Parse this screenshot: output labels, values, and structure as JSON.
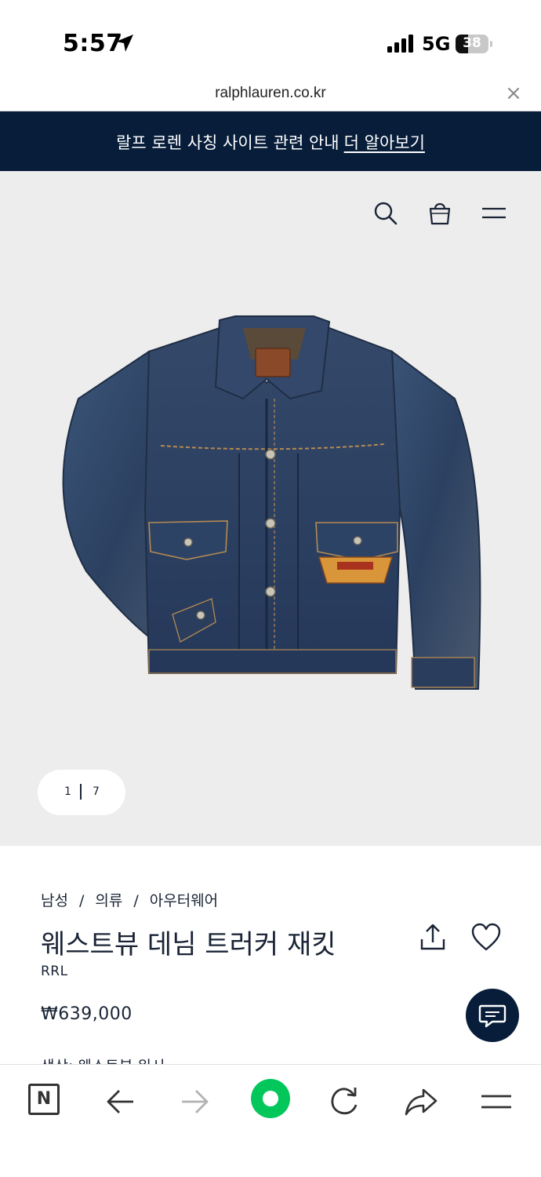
{
  "status_bar": {
    "time": "5:57",
    "network": "5G",
    "battery_level": "38",
    "battery_fraction": 0.38
  },
  "browser": {
    "url": "ralphlauren.co.kr",
    "close_symbol": "×"
  },
  "banner": {
    "text": "랄프 로렌 사칭 사이트 관련 안내",
    "link_text": "더 알아보기",
    "background": "#071d3a"
  },
  "header_icons": [
    "search-icon",
    "shopping-bag-icon",
    "menu-icon"
  ],
  "gallery": {
    "current": "1",
    "total": "7",
    "background": "#eeeded"
  },
  "product": {
    "breadcrumb": [
      "남성",
      "의류",
      "아우터웨어"
    ],
    "breadcrumb_separator": "/",
    "title": "웨스트뷰 데님 트러커 재킷",
    "brand": "RRL",
    "price": "₩639,000",
    "color_label": "색상: 웨스트뷰 워시"
  },
  "actions": {
    "share_icon": "share-icon",
    "favorite_icon": "heart-icon",
    "chat_icon": "chat-icon"
  },
  "toolbar": {
    "home_label": "N",
    "items": [
      "naver-home-icon",
      "back-arrow-icon",
      "forward-arrow-icon",
      "green-dot-icon",
      "reload-icon",
      "share-arrow-icon",
      "menu-icon"
    ],
    "accent": "#03c75a"
  }
}
